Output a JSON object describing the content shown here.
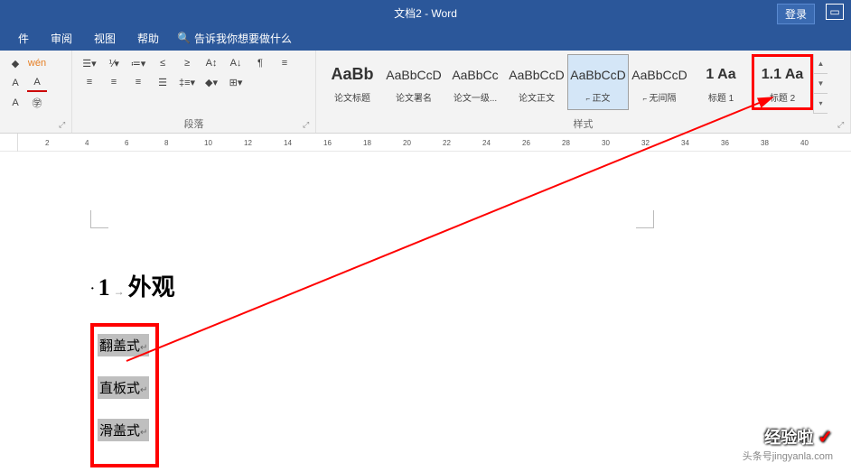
{
  "titlebar": {
    "title": "文档2 - Word",
    "login": "登录"
  },
  "menubar": {
    "tabs": [
      "件",
      "审阅",
      "视图",
      "帮助"
    ],
    "search_placeholder": "告诉我你想要做什么"
  },
  "ribbon": {
    "paragraph_label": "段落",
    "styles_label": "样式",
    "styles": [
      {
        "preview": "AaBb",
        "name": "论文标题",
        "big": true
      },
      {
        "preview": "AaBbCcD",
        "name": "论文署名"
      },
      {
        "preview": "AaBbCc",
        "name": "论文一级..."
      },
      {
        "preview": "AaBbCcD",
        "name": "论文正文"
      },
      {
        "preview": "AaBbCcD",
        "name": "正文",
        "corner": true,
        "selected": true
      },
      {
        "preview": "AaBbCcD",
        "name": "无间隔",
        "corner": true
      },
      {
        "preview": "1 Aa",
        "name": "标题 1",
        "num": true
      },
      {
        "preview": "1.1 Aa",
        "name": "标题 2",
        "num": true,
        "highlighted": true
      }
    ]
  },
  "ruler": {
    "ticks": [
      2,
      4,
      6,
      8,
      10,
      12,
      14,
      16,
      18,
      20,
      22,
      24,
      26,
      28,
      30,
      32,
      34,
      36,
      38,
      40
    ]
  },
  "document": {
    "heading_number": "1",
    "heading_text": "外观",
    "selected_items": [
      "翻盖式",
      "直板式",
      "滑盖式"
    ]
  },
  "watermark": {
    "line1": "经验啦",
    "line2": "头条号jingyanla.com"
  }
}
